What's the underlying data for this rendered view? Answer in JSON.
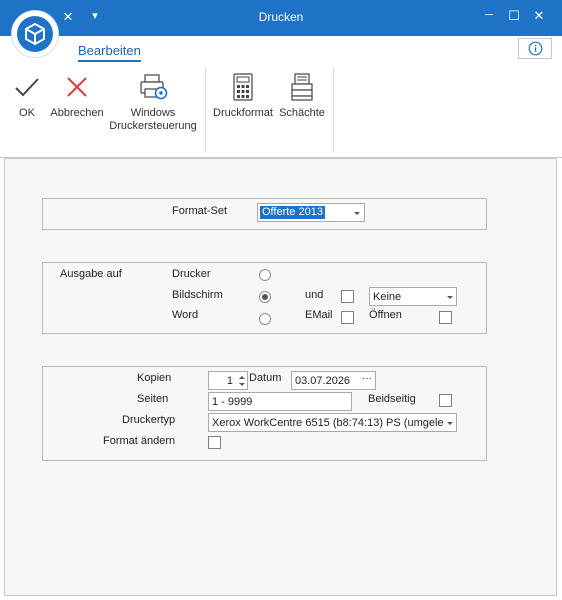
{
  "window": {
    "title": "Drucken",
    "close_glyph": "×",
    "qat_dropdown_glyph": "▾",
    "minimize_glyph": "─",
    "maximize_glyph": "☐",
    "winclose_glyph": "✕",
    "accent": "#1e73c6"
  },
  "ribbon": {
    "tab": "Bearbeiten",
    "info_icon": "info-icon",
    "buttons": {
      "ok": "OK",
      "cancel": "Abbrechen",
      "windows_line1": "Windows",
      "windows_line2": "Druckersteuerung",
      "druckformat": "Druckformat",
      "schaechte": "Schächte"
    }
  },
  "format_set": {
    "label": "Format-Set",
    "value": "Offerte 2013"
  },
  "ausgabe": {
    "label": "Ausgabe auf",
    "options": [
      "Drucker",
      "Bildschirm",
      "Word"
    ],
    "selected": "Bildschirm",
    "und_label": "und",
    "email_label": "EMail",
    "oeffnen_label": "Öffnen",
    "keine_value": "Keine"
  },
  "print_settings": {
    "kopien_label": "Kopien",
    "kopien_value": "1",
    "datum_label": "Datum",
    "datum_value": "03.07.2026",
    "datum_button": "···",
    "seiten_label": "Seiten",
    "seiten_value": "1 - 9999",
    "beidseitig_label": "Beidseitig",
    "druckertyp_label": "Druckertyp",
    "druckertyp_value": "Xerox WorkCentre 6515 (b8:74:13) PS (umgele",
    "format_aendern_label": "Format ändern"
  }
}
